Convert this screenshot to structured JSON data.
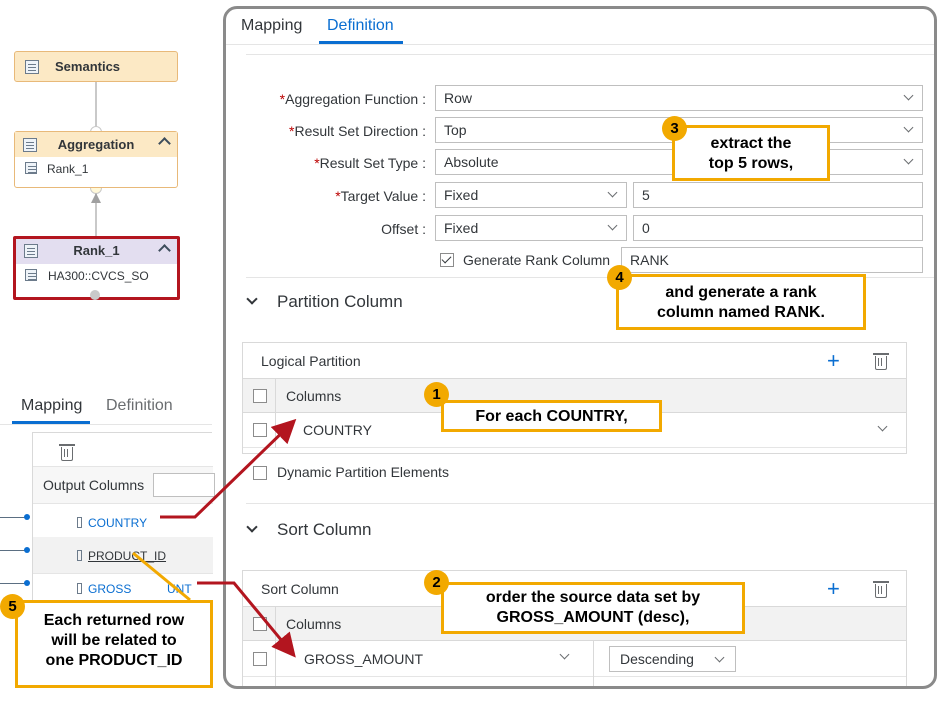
{
  "graph": {
    "semantics_label": "Semantics",
    "aggregation_label": "Aggregation",
    "aggregation_input": "Rank_1",
    "rank_label": "Rank_1",
    "rank_input": "HA300::CVCS_SO"
  },
  "left_panel": {
    "tab_mapping": "Mapping",
    "tab_definition": "Definition",
    "output_columns_label": "Output Columns",
    "rows": [
      "COUNTRY",
      "PRODUCT_ID",
      "GROSS_AMOUNT"
    ],
    "row_gross_visible": "GROSS",
    "row_gross_tail": "UNT"
  },
  "right_panel": {
    "tab_mapping": "Mapping",
    "tab_definition": "Definition",
    "form": {
      "aggregation_function_label": "Aggregation Function :",
      "aggregation_function_value": "Row",
      "result_set_direction_label": "Result Set Direction :",
      "result_set_direction_value": "Top",
      "result_set_type_label": "Result Set Type :",
      "result_set_type_value": "Absolute",
      "target_value_label": "Target Value :",
      "target_value_type": "Fixed",
      "target_value": "5",
      "offset_label": "Offset :",
      "offset_type": "Fixed",
      "offset_value": "0",
      "generate_rank_label": "Generate Rank Column",
      "generate_rank_checked": true,
      "rank_column_name": "RANK",
      "required_marker": "*"
    },
    "partition_section": {
      "title": "Partition Column",
      "grid_title": "Logical Partition",
      "columns_header": "Columns",
      "row_value": "COUNTRY",
      "dynamic_label": "Dynamic Partition Elements"
    },
    "sort_section": {
      "title": "Sort Column",
      "grid_title": "Sort Column",
      "columns_header": "Columns",
      "row_value": "GROSS_AMOUNT",
      "order_value": "Descending"
    }
  },
  "callouts": {
    "c1_num": "1",
    "c1_text": "For each COUNTRY,",
    "c2_num": "2",
    "c2_line1": "order the source data set by",
    "c2_line2": "GROSS_AMOUNT (desc),",
    "c3_num": "3",
    "c3_line1": "extract the",
    "c3_line2": "top 5 rows,",
    "c4_num": "4",
    "c4_line1": "and generate a rank",
    "c4_line2": "column named RANK.",
    "c5_num": "5",
    "c5_line1": "Each returned row",
    "c5_line2": "will be related to",
    "c5_line3": "one PRODUCT_ID"
  },
  "colors": {
    "accent": "#0a6ed1",
    "callout": "#f2a900",
    "arrow": "#b3151f",
    "highlight_border": "#b3151f"
  }
}
